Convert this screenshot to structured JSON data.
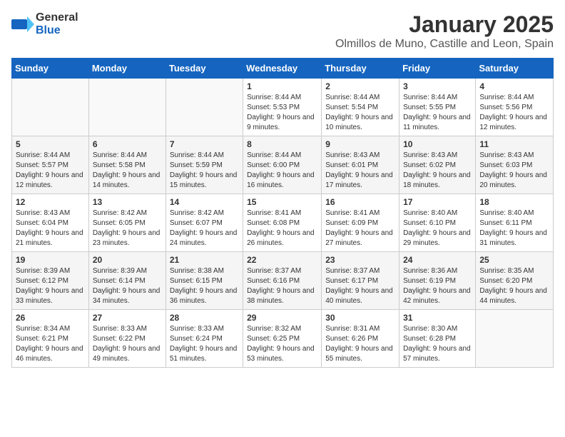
{
  "header": {
    "logo_general": "General",
    "logo_blue": "Blue",
    "month_title": "January 2025",
    "location": "Olmillos de Muno, Castille and Leon, Spain"
  },
  "weekdays": [
    "Sunday",
    "Monday",
    "Tuesday",
    "Wednesday",
    "Thursday",
    "Friday",
    "Saturday"
  ],
  "weeks": [
    [
      {
        "day": "",
        "info": ""
      },
      {
        "day": "",
        "info": ""
      },
      {
        "day": "",
        "info": ""
      },
      {
        "day": "1",
        "info": "Sunrise: 8:44 AM\nSunset: 5:53 PM\nDaylight: 9 hours and 9 minutes."
      },
      {
        "day": "2",
        "info": "Sunrise: 8:44 AM\nSunset: 5:54 PM\nDaylight: 9 hours and 10 minutes."
      },
      {
        "day": "3",
        "info": "Sunrise: 8:44 AM\nSunset: 5:55 PM\nDaylight: 9 hours and 11 minutes."
      },
      {
        "day": "4",
        "info": "Sunrise: 8:44 AM\nSunset: 5:56 PM\nDaylight: 9 hours and 12 minutes."
      }
    ],
    [
      {
        "day": "5",
        "info": "Sunrise: 8:44 AM\nSunset: 5:57 PM\nDaylight: 9 hours and 12 minutes."
      },
      {
        "day": "6",
        "info": "Sunrise: 8:44 AM\nSunset: 5:58 PM\nDaylight: 9 hours and 14 minutes."
      },
      {
        "day": "7",
        "info": "Sunrise: 8:44 AM\nSunset: 5:59 PM\nDaylight: 9 hours and 15 minutes."
      },
      {
        "day": "8",
        "info": "Sunrise: 8:44 AM\nSunset: 6:00 PM\nDaylight: 9 hours and 16 minutes."
      },
      {
        "day": "9",
        "info": "Sunrise: 8:43 AM\nSunset: 6:01 PM\nDaylight: 9 hours and 17 minutes."
      },
      {
        "day": "10",
        "info": "Sunrise: 8:43 AM\nSunset: 6:02 PM\nDaylight: 9 hours and 18 minutes."
      },
      {
        "day": "11",
        "info": "Sunrise: 8:43 AM\nSunset: 6:03 PM\nDaylight: 9 hours and 20 minutes."
      }
    ],
    [
      {
        "day": "12",
        "info": "Sunrise: 8:43 AM\nSunset: 6:04 PM\nDaylight: 9 hours and 21 minutes."
      },
      {
        "day": "13",
        "info": "Sunrise: 8:42 AM\nSunset: 6:05 PM\nDaylight: 9 hours and 23 minutes."
      },
      {
        "day": "14",
        "info": "Sunrise: 8:42 AM\nSunset: 6:07 PM\nDaylight: 9 hours and 24 minutes."
      },
      {
        "day": "15",
        "info": "Sunrise: 8:41 AM\nSunset: 6:08 PM\nDaylight: 9 hours and 26 minutes."
      },
      {
        "day": "16",
        "info": "Sunrise: 8:41 AM\nSunset: 6:09 PM\nDaylight: 9 hours and 27 minutes."
      },
      {
        "day": "17",
        "info": "Sunrise: 8:40 AM\nSunset: 6:10 PM\nDaylight: 9 hours and 29 minutes."
      },
      {
        "day": "18",
        "info": "Sunrise: 8:40 AM\nSunset: 6:11 PM\nDaylight: 9 hours and 31 minutes."
      }
    ],
    [
      {
        "day": "19",
        "info": "Sunrise: 8:39 AM\nSunset: 6:12 PM\nDaylight: 9 hours and 33 minutes."
      },
      {
        "day": "20",
        "info": "Sunrise: 8:39 AM\nSunset: 6:14 PM\nDaylight: 9 hours and 34 minutes."
      },
      {
        "day": "21",
        "info": "Sunrise: 8:38 AM\nSunset: 6:15 PM\nDaylight: 9 hours and 36 minutes."
      },
      {
        "day": "22",
        "info": "Sunrise: 8:37 AM\nSunset: 6:16 PM\nDaylight: 9 hours and 38 minutes."
      },
      {
        "day": "23",
        "info": "Sunrise: 8:37 AM\nSunset: 6:17 PM\nDaylight: 9 hours and 40 minutes."
      },
      {
        "day": "24",
        "info": "Sunrise: 8:36 AM\nSunset: 6:19 PM\nDaylight: 9 hours and 42 minutes."
      },
      {
        "day": "25",
        "info": "Sunrise: 8:35 AM\nSunset: 6:20 PM\nDaylight: 9 hours and 44 minutes."
      }
    ],
    [
      {
        "day": "26",
        "info": "Sunrise: 8:34 AM\nSunset: 6:21 PM\nDaylight: 9 hours and 46 minutes."
      },
      {
        "day": "27",
        "info": "Sunrise: 8:33 AM\nSunset: 6:22 PM\nDaylight: 9 hours and 49 minutes."
      },
      {
        "day": "28",
        "info": "Sunrise: 8:33 AM\nSunset: 6:24 PM\nDaylight: 9 hours and 51 minutes."
      },
      {
        "day": "29",
        "info": "Sunrise: 8:32 AM\nSunset: 6:25 PM\nDaylight: 9 hours and 53 minutes."
      },
      {
        "day": "30",
        "info": "Sunrise: 8:31 AM\nSunset: 6:26 PM\nDaylight: 9 hours and 55 minutes."
      },
      {
        "day": "31",
        "info": "Sunrise: 8:30 AM\nSunset: 6:28 PM\nDaylight: 9 hours and 57 minutes."
      },
      {
        "day": "",
        "info": ""
      }
    ]
  ]
}
